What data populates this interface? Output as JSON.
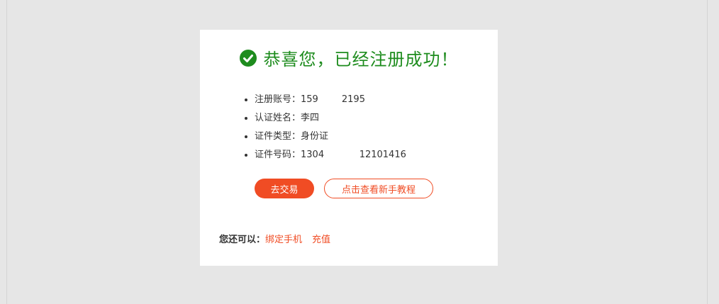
{
  "success": {
    "title": "恭喜您，已经注册成功！",
    "icon": "check-circle-icon",
    "color": "#1e8c1e"
  },
  "account_info": [
    {
      "label": "注册账号：",
      "value": "159        2195"
    },
    {
      "label": "认证姓名：",
      "value": "李四"
    },
    {
      "label": "证件类型：",
      "value": "身份证"
    },
    {
      "label": "证件号码：",
      "value": "1304            12101416"
    }
  ],
  "actions": {
    "trade_label": "去交易",
    "tutorial_label": "点击查看新手教程",
    "accent_color": "#f04c24"
  },
  "more": {
    "label": "您还可以：",
    "links": [
      "绑定手机",
      "充值"
    ]
  }
}
